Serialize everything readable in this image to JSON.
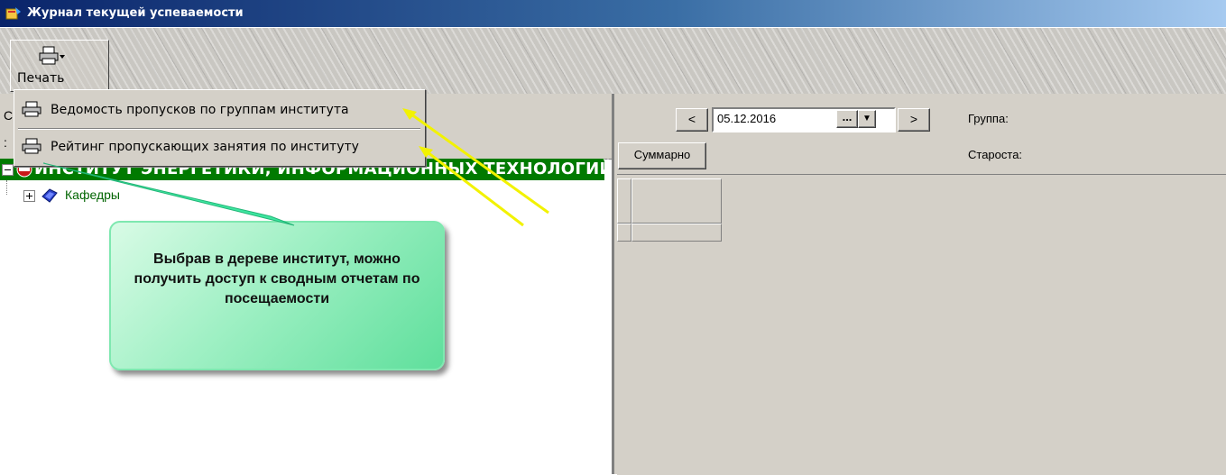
{
  "window": {
    "title": "Журнал текущей успеваемости"
  },
  "toolbar": {
    "print_label": "Печать"
  },
  "left_panel": {
    "header_fragment_1": "С",
    "header_fragment_2": ":"
  },
  "print_menu": {
    "items": [
      {
        "label": "Ведомость пропусков по группам института"
      },
      {
        "label": "Рейтинг пропускающих занятия по институту"
      }
    ]
  },
  "tree": {
    "root_label": "ИНСТИТУТ ЭНЕРГЕТИКИ, ИНФОРМАЦИОННЫХ ТЕХНОЛОГИЙ",
    "child_label": "Кафедры"
  },
  "journal": {
    "prev_label": "<",
    "next_label": ">",
    "date_value": "05.12.2016",
    "dots_label": "...",
    "dropdown_label": "▼",
    "group_label": "Группа:",
    "headman_label": "Староста:",
    "summary_button": "Суммарно"
  },
  "callout": {
    "text": "Выбрав в дереве институт, можно получить доступ к сводным отчетам по посещаемости"
  },
  "colors": {
    "title_bar": "#0a246a",
    "tree_root_bg": "#007a00",
    "callout_fill": "#9ff0c4",
    "arrow_green": "#3ee6a0",
    "arrow_yellow": "#f2f200"
  }
}
